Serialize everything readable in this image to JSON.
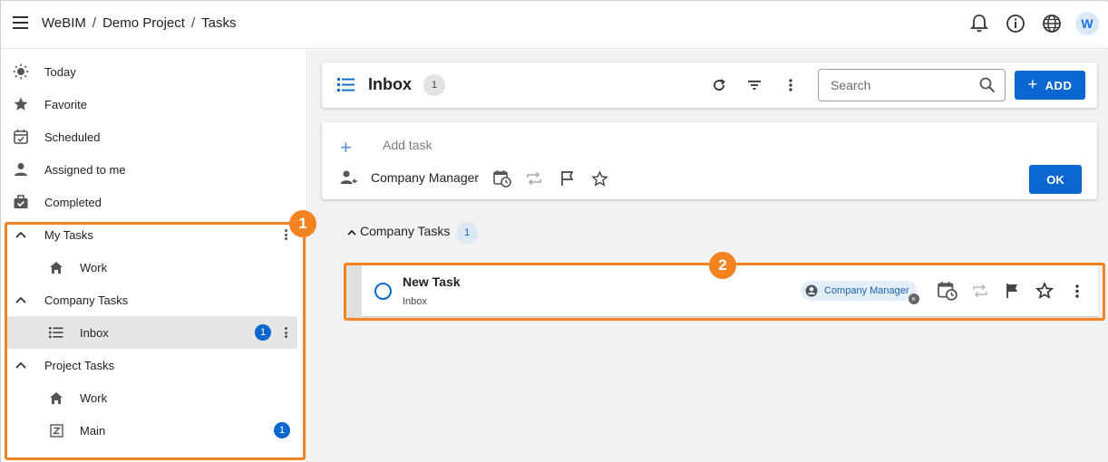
{
  "header": {
    "breadcrumb": [
      "WeBIM",
      "Demo Project",
      "Tasks"
    ],
    "separator": "/",
    "avatar_letter": "W"
  },
  "sidebar": {
    "items": [
      {
        "label": "Today",
        "icon": "sun-icon"
      },
      {
        "label": "Favorite",
        "icon": "star-icon"
      },
      {
        "label": "Scheduled",
        "icon": "calendar-check-icon"
      },
      {
        "label": "Assigned to me",
        "icon": "person-icon"
      },
      {
        "label": "Completed",
        "icon": "briefcase-check-icon"
      }
    ],
    "groups": {
      "my_tasks": {
        "label": "My Tasks",
        "children": [
          {
            "label": "Work",
            "icon": "home-icon"
          }
        ]
      },
      "company_tasks": {
        "label": "Company Tasks",
        "children": [
          {
            "label": "Inbox",
            "icon": "list-icon",
            "count": "1"
          }
        ]
      },
      "project_tasks": {
        "label": "Project Tasks",
        "children": [
          {
            "label": "Work",
            "icon": "home-icon"
          },
          {
            "label": "Main",
            "icon": "z-box-icon",
            "count": "1"
          }
        ]
      }
    }
  },
  "main": {
    "title": "Inbox",
    "title_count": "1",
    "search_placeholder": "Search",
    "add_label": "ADD",
    "add_task_placeholder": "Add task",
    "assignee": "Company Manager",
    "ok_label": "OK",
    "group": {
      "label": "Company Tasks",
      "count": "1"
    },
    "task": {
      "title": "New Task",
      "list": "Inbox",
      "assignee_chip": "Company Manager"
    }
  },
  "callouts": [
    "1",
    "2"
  ],
  "colors": {
    "accent": "#0b67d0",
    "callout": "#f58220",
    "active_bg": "#e6e6e6"
  }
}
